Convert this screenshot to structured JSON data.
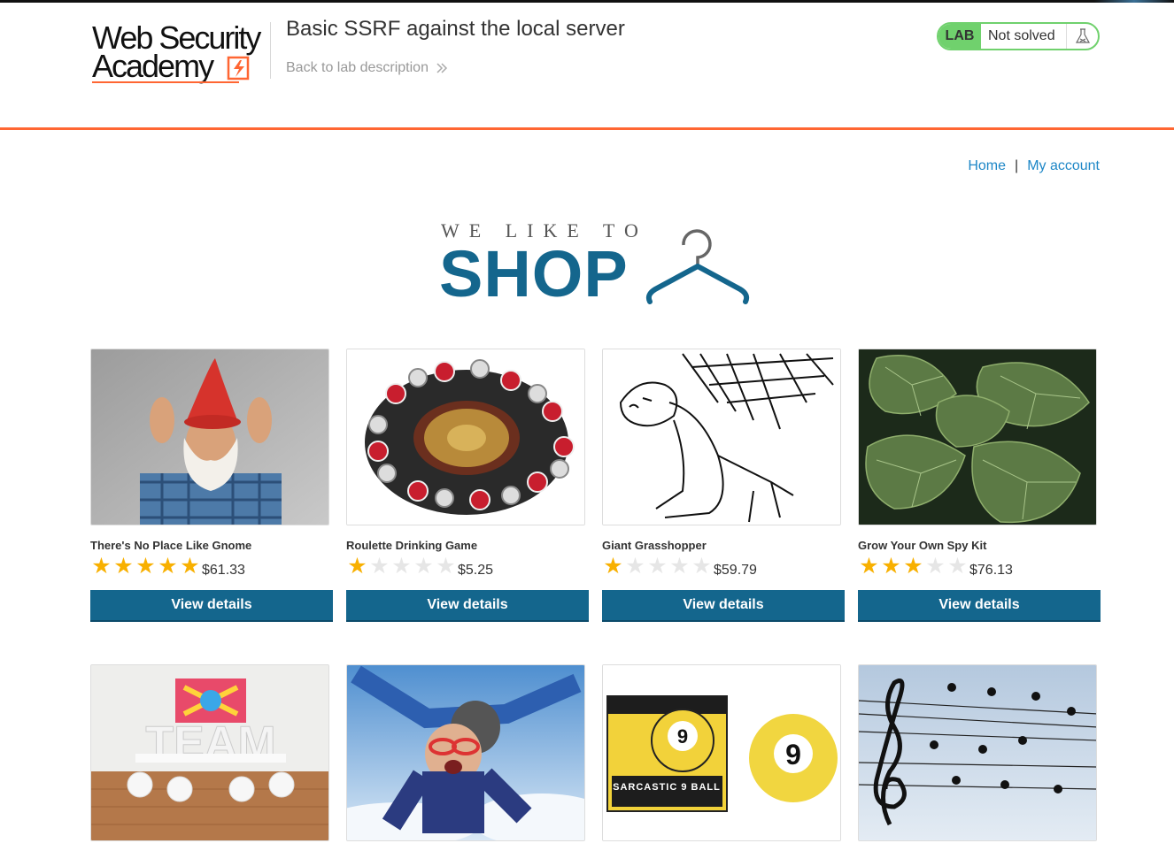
{
  "header": {
    "logo_line1": "Web Security",
    "logo_line2": "Academy",
    "lab_title": "Basic SSRF against the local server",
    "back_link": "Back to lab description",
    "lab_badge": "LAB",
    "lab_status": "Not solved"
  },
  "nav": {
    "home": "Home",
    "separator": "|",
    "my_account": "My account"
  },
  "banner": {
    "line1": "WE LIKE TO",
    "line2": "SHOP"
  },
  "colors": {
    "accent_orange": "#ff6633",
    "button_blue": "#14668d",
    "link_blue": "#1e87c7",
    "lab_green": "#70d16d",
    "star_gold": "#f8b000"
  },
  "products": [
    {
      "name": "There's No Place Like Gnome",
      "rating": 5,
      "price": "$61.33",
      "button": "View details",
      "image": "gnome-photo"
    },
    {
      "name": "Roulette Drinking Game",
      "rating": 1,
      "price": "$5.25",
      "button": "View details",
      "image": "roulette-photo"
    },
    {
      "name": "Giant Grasshopper",
      "rating": 1,
      "price": "$59.79",
      "button": "View details",
      "image": "grasshopper-drawing"
    },
    {
      "name": "Grow Your Own Spy Kit",
      "rating": 3,
      "price": "$76.13",
      "button": "View details",
      "image": "leaves-photo"
    },
    {
      "image": "team-photo",
      "image_text": "TEAM"
    },
    {
      "image": "skydivers-photo"
    },
    {
      "image": "sarcastic-9-ball-photo",
      "image_text": "SARCASTIC 9 BALL"
    },
    {
      "image": "music-birds-photo"
    }
  ]
}
